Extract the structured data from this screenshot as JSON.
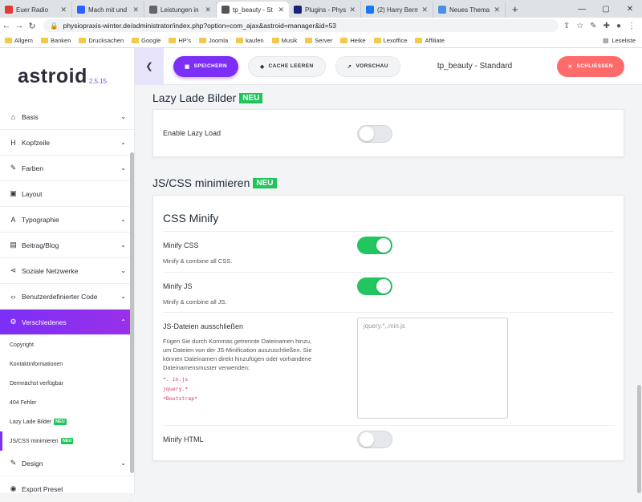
{
  "browser": {
    "tabs": [
      {
        "title": "Euer Radio",
        "color": "#e53935",
        "active": false
      },
      {
        "title": "Mach mit und",
        "color": "#2962ff",
        "active": false
      },
      {
        "title": "Leistungen in",
        "color": "#666666",
        "active": false
      },
      {
        "title": "tp_beauty - St",
        "color": "#555555",
        "active": true
      },
      {
        "title": "Plugins - Phys",
        "color": "#1a237e",
        "active": false
      },
      {
        "title": "(2) Harry Berm",
        "color": "#1877f2",
        "active": false
      },
      {
        "title": "Neues Thema",
        "color": "#4a90e2",
        "active": false
      }
    ],
    "url": "physiopraxis-winter.de/administrator/index.php?option=com_ajax&astroid=manager&id=53",
    "bookmarks": [
      "Allgem",
      "Banken",
      "Drucksachen",
      "Google",
      "HP's",
      "Joomla",
      "kaufen",
      "Musik",
      "Server",
      "Heike",
      "Lexoffice",
      "Affiliate"
    ],
    "reading_list": "Leseliste"
  },
  "sidebar": {
    "logo": "astroid",
    "version": "2.5.15",
    "items": [
      {
        "label": "Basis",
        "icon": "home-icon",
        "glyph": "⌂"
      },
      {
        "label": "Kopfzeile",
        "icon": "heading-icon",
        "glyph": "H"
      },
      {
        "label": "Farben",
        "icon": "brush-icon",
        "glyph": "✎"
      },
      {
        "label": "Layout",
        "icon": "layout-icon",
        "glyph": "▣"
      },
      {
        "label": "Typographie",
        "icon": "font-icon",
        "glyph": "A"
      },
      {
        "label": "Beitrag/Blog",
        "icon": "blog-icon",
        "glyph": "▤"
      },
      {
        "label": "Soziale Netzwerke",
        "icon": "share-icon",
        "glyph": "⋖"
      },
      {
        "label": "Benutzerdefinierter Code",
        "icon": "code-icon",
        "glyph": "‹›"
      },
      {
        "label": "Verschiedenes",
        "icon": "cogs-icon",
        "glyph": "⚙"
      }
    ],
    "subitems": [
      "Copyright",
      "Kontaktinformationen",
      "Demnächst verfügbar",
      "404 Fehler",
      "Lazy Lade Bilder",
      "JS/CSS minimieren"
    ],
    "badge": "NEU",
    "bottom_items": [
      {
        "label": "Design",
        "icon": "brush-icon",
        "glyph": "✎"
      },
      {
        "label": "Export Preset",
        "icon": "export-icon",
        "glyph": "◉"
      }
    ]
  },
  "toolbar": {
    "save": "SPEICHERN",
    "cache": "CACHE LEEREN",
    "preview": "VORSCHAU",
    "title": "tp_beauty - Standard",
    "close": "SCHLIESSEN"
  },
  "lazy": {
    "title": "Lazy Lade Bilder",
    "badge": "NEU",
    "enable_label": "Enable Lazy Load",
    "enabled": false
  },
  "minify": {
    "title": "JS/CSS minimieren",
    "badge": "NEU",
    "card_title": "CSS Minify",
    "css_label": "Minify CSS",
    "css_desc": "Minify & combine all CSS.",
    "css_on": true,
    "js_label": "Minify JS",
    "js_desc": "Minify & combine all JS.",
    "js_on": true,
    "exclude_label": "JS-Dateien ausschließen",
    "exclude_desc_1": "Fügen Sie durch Kommas getrennte Dateinamen hinzu,",
    "exclude_desc_2": "um Dateien von der JS-Minification auszuschließen. Sie",
    "exclude_desc_3": "können Dateinamen direkt hinzufügen oder vorhandene",
    "exclude_desc_4": "Dateinamensmuster verwenden:",
    "example_1": "*. in.js",
    "example_2": "jquery.*",
    "example_3": "*Bootstrap*",
    "exclude_placeholder": "jquery.*,.min.js",
    "html_label": "Minify HTML",
    "html_on": false
  }
}
